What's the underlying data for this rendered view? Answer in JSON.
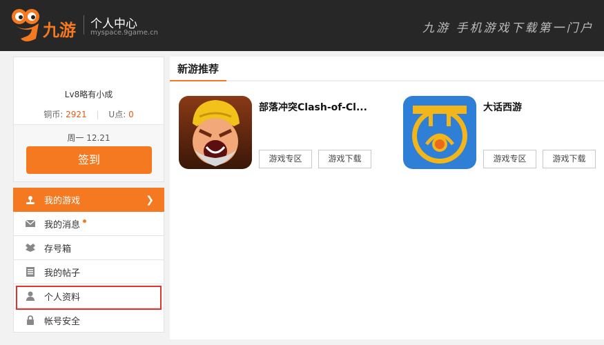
{
  "header": {
    "brand": "九游",
    "title": "个人中心",
    "subtitle": "myspace.9game.cn",
    "slogan": "九游 手机游戏下载第一门户"
  },
  "profile": {
    "level": "Lv8略有小成",
    "coins_label": "铜币:",
    "coins_value": "2921",
    "u_label": "U点:",
    "u_value": "0",
    "date": "周一 12.21",
    "sign_label": "签到"
  },
  "menu": {
    "items": [
      {
        "label": "我的游戏",
        "icon": "joystick-icon"
      },
      {
        "label": "我的消息",
        "icon": "mail-icon"
      },
      {
        "label": "存号箱",
        "icon": "box-icon"
      },
      {
        "label": "我的帖子",
        "icon": "document-icon"
      },
      {
        "label": "个人资料",
        "icon": "user-icon"
      },
      {
        "label": "帐号安全",
        "icon": "lock-icon"
      }
    ]
  },
  "main": {
    "section_title": "新游推荐",
    "games": [
      {
        "name": "部落冲突Clash-of-Cl...",
        "zone_label": "游戏专区",
        "download_label": "游戏下载"
      },
      {
        "name": "大话西游",
        "zone_label": "游戏专区",
        "download_label": "游戏下载"
      }
    ]
  },
  "colors": {
    "accent": "#f47920",
    "header_bg": "#272727",
    "highlight": "#e23232"
  }
}
